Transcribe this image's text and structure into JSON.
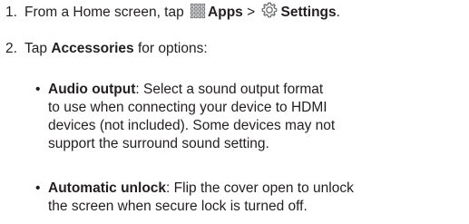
{
  "steps": [
    {
      "number": "1.",
      "prefix": "From a Home screen, tap",
      "apps_label": "Apps",
      "separator": ">",
      "settings_label": "Settings",
      "suffix": "."
    },
    {
      "number": "2.",
      "prefix": "Tap",
      "bold": "Accessories",
      "suffix": "for options:"
    }
  ],
  "bullets": [
    {
      "marker": "•",
      "title": "Audio output",
      "lines": [
        ": Select a sound output format",
        "to use when connecting your device to HDMI",
        "devices (not included). Some devices may not",
        "support the surround sound setting."
      ]
    },
    {
      "marker": "•",
      "title": "Automatic unlock",
      "lines": [
        ": Flip the cover open to unlock",
        "the screen when secure lock is turned off."
      ]
    }
  ],
  "icons": {
    "apps": "apps-grid-icon",
    "settings": "settings-gear-icon"
  },
  "colors": {
    "text": "#231f20",
    "icon": "#6d6e71"
  }
}
